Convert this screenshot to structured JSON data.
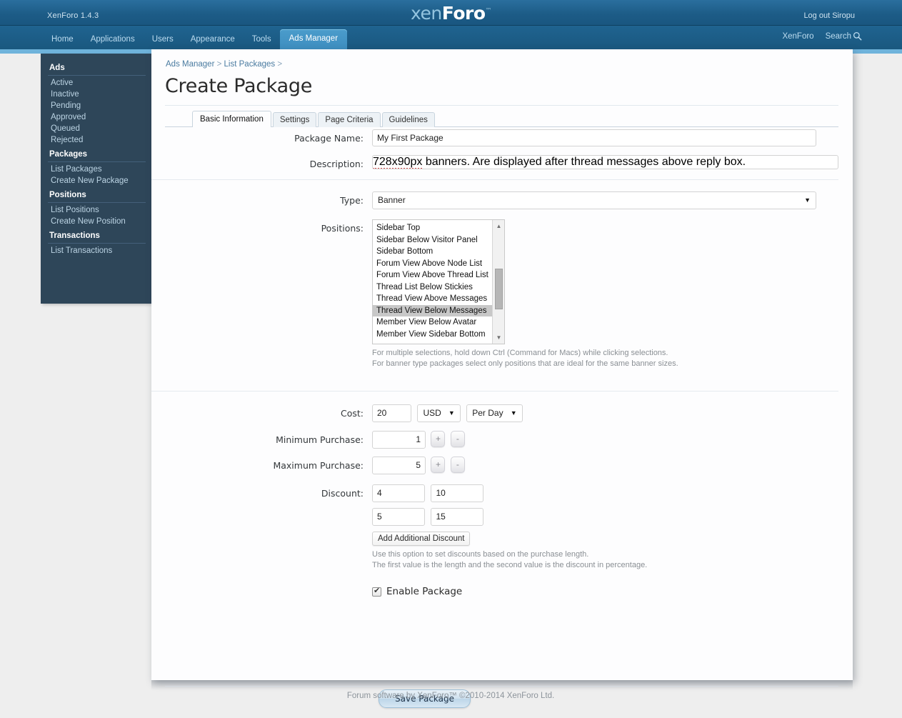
{
  "header": {
    "version": "XenForo 1.4.3",
    "logout": "Log out Siropu",
    "logo_part1": "xen",
    "logo_part2": "Foro",
    "logo_tm": "™"
  },
  "nav": {
    "tabs": [
      {
        "label": "Home",
        "active": false
      },
      {
        "label": "Applications",
        "active": false
      },
      {
        "label": "Users",
        "active": false
      },
      {
        "label": "Appearance",
        "active": false
      },
      {
        "label": "Tools",
        "active": false
      },
      {
        "label": "Ads Manager",
        "active": true
      }
    ],
    "right_links": [
      {
        "label": "XenForo"
      },
      {
        "label": "Search",
        "icon": "search-icon"
      }
    ]
  },
  "sidebar": {
    "groups": [
      {
        "title": "Ads",
        "items": [
          "Active",
          "Inactive",
          "Pending",
          "Approved",
          "Queued",
          "Rejected"
        ]
      },
      {
        "title": "Packages",
        "items": [
          "List Packages",
          "Create New Package"
        ]
      },
      {
        "title": "Positions",
        "items": [
          "List Positions",
          "Create New Position"
        ]
      },
      {
        "title": "Transactions",
        "items": [
          "List Transactions"
        ]
      }
    ]
  },
  "breadcrumb": {
    "items": [
      "Ads Manager",
      "List Packages"
    ],
    "separator": ">"
  },
  "page": {
    "title": "Create Package"
  },
  "tabs": [
    {
      "label": "Basic Information",
      "active": true
    },
    {
      "label": "Settings",
      "active": false
    },
    {
      "label": "Page Criteria",
      "active": false
    },
    {
      "label": "Guidelines",
      "active": false
    }
  ],
  "form": {
    "package_name": {
      "label": "Package Name:",
      "value": "My First Package",
      "placeholder": ""
    },
    "description": {
      "label": "Description:",
      "value_spell": "728x90px",
      "value_rest": " banners. Are displayed after thread messages above reply box.",
      "placeholder": ""
    },
    "type": {
      "label": "Type:",
      "value": "Banner",
      "caret": "▼"
    },
    "positions": {
      "label": "Positions:",
      "options": [
        "Sidebar Top",
        "Sidebar Below Visitor Panel",
        "Sidebar Bottom",
        "Forum View Above Node List",
        "Forum View Above Thread List",
        "Thread List Below Stickies",
        "Thread View Above Messages",
        "Thread View Below Messages",
        "Member View Below Avatar",
        "Member View Sidebar Bottom"
      ],
      "selected": "Thread View Below Messages",
      "scroll_up": "▲",
      "scroll_down": "▼",
      "hint_line1": "For multiple selections, hold down Ctrl (Command for Macs) while clicking selections.",
      "hint_line2": "For banner type packages select only positions that are ideal for the same banner sizes."
    },
    "cost": {
      "label": "Cost:",
      "value": "20",
      "currency": "USD",
      "currency_caret": "▼",
      "period": "Per Day",
      "period_caret": "▼"
    },
    "minimum_purchase": {
      "label": "Minimum Purchase:",
      "value": "1",
      "increment": "+",
      "decrement": "-"
    },
    "maximum_purchase": {
      "label": "Maximum Purchase:",
      "value": "5",
      "increment": "+",
      "decrement": "-"
    },
    "discount": {
      "label": "Discount:",
      "rows": [
        {
          "length": "4",
          "percent": "10"
        },
        {
          "length": "5",
          "percent": "15"
        }
      ],
      "add_button": "Add Additional Discount",
      "hint_line1": "Use this option to set discounts based on the purchase length.",
      "hint_line2": "The first value is the length and the second value is the discount in percentage."
    },
    "enable_package": {
      "label": "Enable Package",
      "checked": true
    },
    "save_button": "Save Package"
  },
  "footer": {
    "text": "Forum software by XenForo™ ©2010-2014 XenForo Ltd."
  },
  "colors": {
    "header_blue": "#1d5c87",
    "nav_blue": "#1a587f",
    "active_tab": "#3d8ec0",
    "underline": "#6fb3db",
    "sidebar": "#2e4659",
    "page_bg": "#eeeeee",
    "panel": "#fdfdfe",
    "link": "#4a7ba0",
    "selected_option": "#c8c8c8"
  }
}
